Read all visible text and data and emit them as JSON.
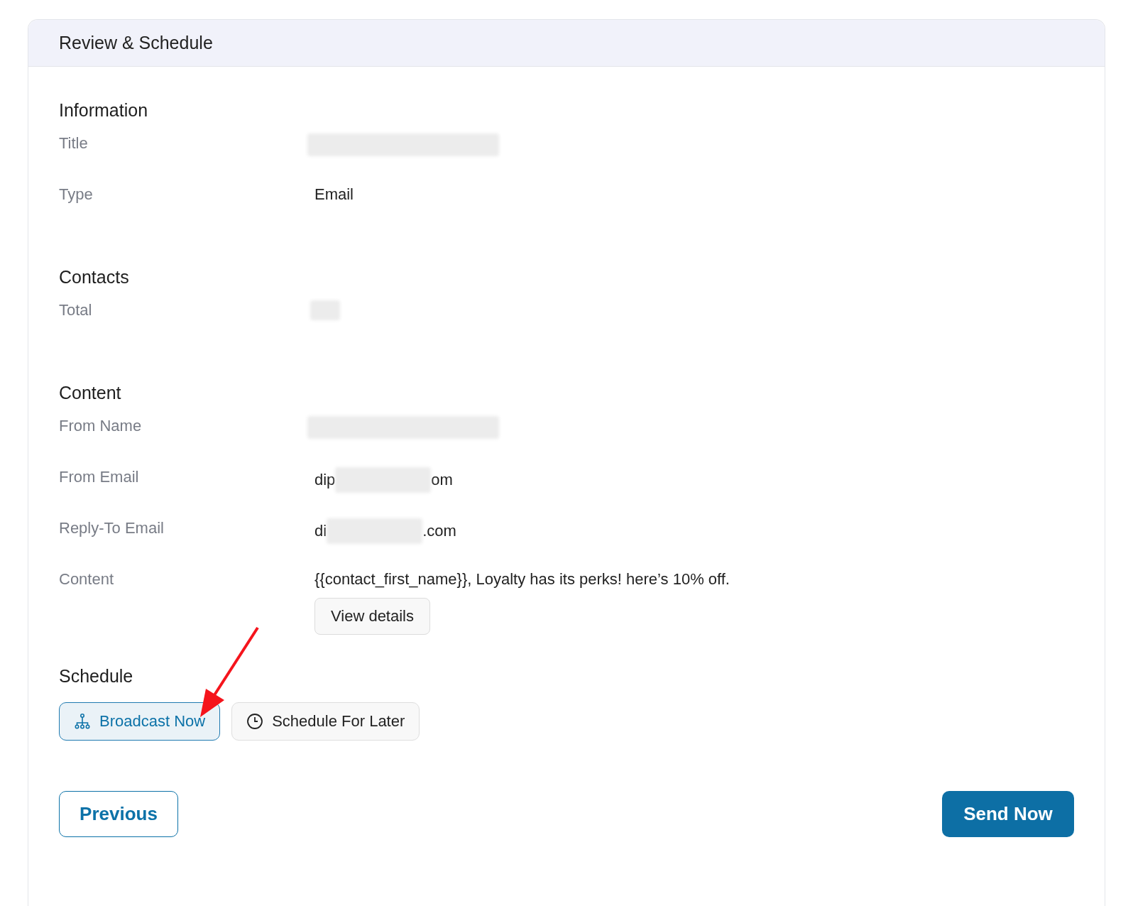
{
  "header": {
    "title": "Review & Schedule"
  },
  "sections": [
    {
      "heading": "Information",
      "rows": [
        {
          "label": "Title",
          "kind": "redacted"
        },
        {
          "label": "Type",
          "kind": "text",
          "value": "Email"
        }
      ]
    },
    {
      "heading": "Contacts",
      "rows": [
        {
          "label": "Total",
          "kind": "redacted_short"
        }
      ]
    },
    {
      "heading": "Content",
      "rows": [
        {
          "label": "From Name",
          "kind": "redacted"
        },
        {
          "label": "From Email",
          "kind": "partial",
          "prefix": "dip",
          "suffix": "om"
        },
        {
          "label": "Reply-To Email",
          "kind": "partial",
          "prefix": "di",
          "suffix": ".com"
        },
        {
          "label": "Content",
          "kind": "text",
          "value": "{{contact_first_name}}, Loyalty has its perks! here’s 10% off.",
          "button": "View details"
        }
      ]
    }
  ],
  "schedule": {
    "heading": "Schedule",
    "options": [
      {
        "label": "Broadcast Now",
        "kind": "broadcast",
        "selected": true
      },
      {
        "label": "Schedule For Later",
        "kind": "later",
        "selected": false
      }
    ]
  },
  "footer": {
    "previous": "Previous",
    "send": "Send Now"
  }
}
